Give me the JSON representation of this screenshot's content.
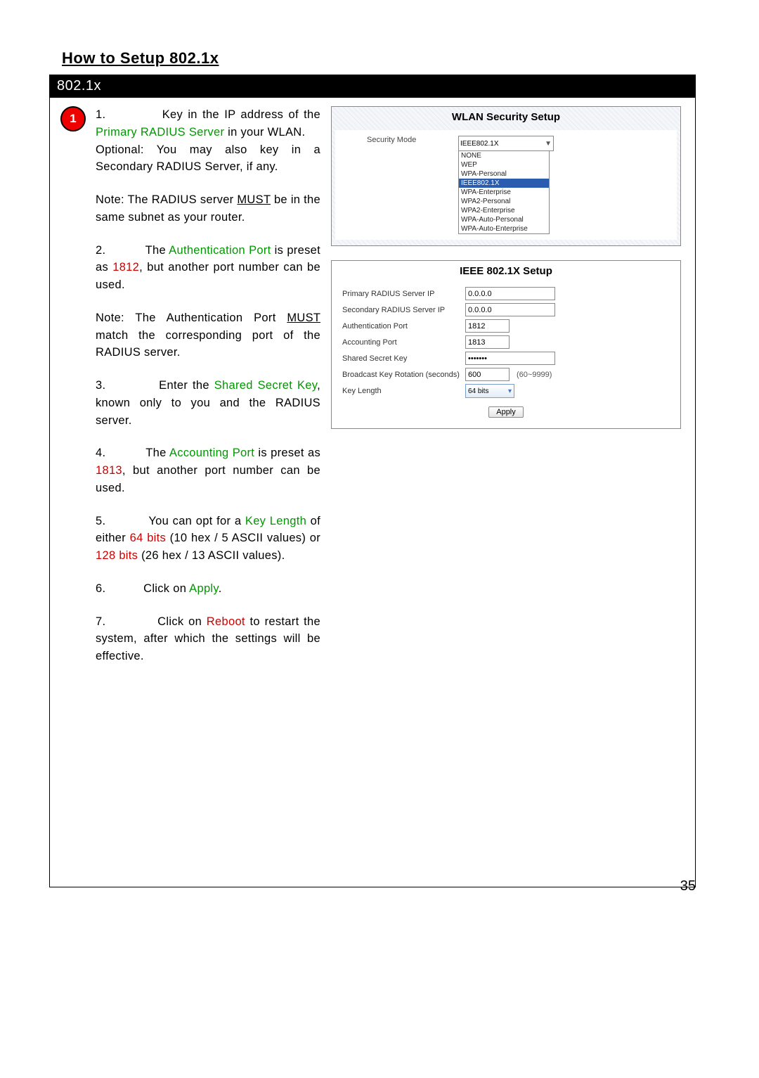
{
  "page_title": "How to Setup 802.1x",
  "section_header": "802.1x",
  "step_badge": "1",
  "instructions": {
    "p1_a": "1.",
    "p1_b": "Key in the IP address of the ",
    "p1_c": "Primary RADIUS Server",
    "p1_d": " in your WLAN.",
    "p1_e": "Optional: You may also key in a Secondary RADIUS Server, if any.",
    "n1_a": "Note: The RADIUS server ",
    "n1_b": "MUST",
    "n1_c": " be in the same subnet as your router.",
    "p2_a": "2.",
    "p2_b": "The ",
    "p2_c": "Authentication Port",
    "p2_d": " is preset as ",
    "p2_e": "1812",
    "p2_f": ", but another port number can be used.",
    "n2_a": "Note: The Authentication Port ",
    "n2_b": "MUST",
    "n2_c": " match the corresponding port of the RADIUS server.",
    "p3_a": "3.",
    "p3_b": "Enter the ",
    "p3_c": "Shared Secret Key",
    "p3_d": ", known only to you and the RADIUS server.",
    "p4_a": "4.",
    "p4_b": "The ",
    "p4_c": "Accounting Port",
    "p4_d": " is preset as ",
    "p4_e": "1813",
    "p4_f": ", but another port number can be used.",
    "p5_a": "5.",
    "p5_b": "You can opt for a ",
    "p5_c": "Key Length",
    "p5_d": " of either ",
    "p5_e": "64 bits",
    "p5_f": " (10 hex / 5 ASCII values) or ",
    "p5_g": "128 bits",
    "p5_h": " (26 hex / 13 ASCII values).",
    "p6_a": "6.",
    "p6_b": "Click on ",
    "p6_c": "Apply",
    "p6_d": ".",
    "p7_a": "7.",
    "p7_b": "Click on ",
    "p7_c": "Reboot",
    "p7_d": " to restart the system, after which the settings will be effective."
  },
  "wlan_panel": {
    "title": "WLAN Security Setup",
    "security_mode_label": "Security Mode",
    "selected_value": "IEEE802.1X",
    "options": {
      "o0": "NONE",
      "o1": "WEP",
      "o2": "WPA-Personal",
      "o3": "IEEE802.1X",
      "o4": "WPA-Enterprise",
      "o5": "WPA2-Personal",
      "o6": "WPA2-Enterprise",
      "o7": "WPA-Auto-Personal",
      "o8": "WPA-Auto-Enterprise"
    }
  },
  "ieee_panel": {
    "title": "IEEE 802.1X Setup",
    "rows": {
      "primary_ip_label": "Primary RADIUS Server IP",
      "primary_ip_value": "0.0.0.0",
      "secondary_ip_label": "Secondary RADIUS Server IP",
      "secondary_ip_value": "0.0.0.0",
      "auth_port_label": "Authentication Port",
      "auth_port_value": "1812",
      "acct_port_label": "Accounting Port",
      "acct_port_value": "1813",
      "shared_key_label": "Shared Secret Key",
      "shared_key_value": "•••••••",
      "rotation_label": "Broadcast Key Rotation (seconds)",
      "rotation_value": "600",
      "rotation_hint": "(60~9999)",
      "keylen_label": "Key Length",
      "keylen_value": "64 bits"
    },
    "apply_label": "Apply"
  },
  "page_number": "35"
}
